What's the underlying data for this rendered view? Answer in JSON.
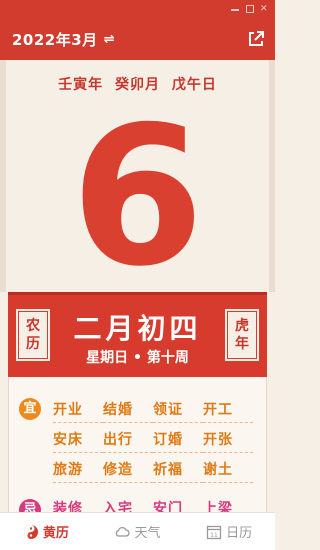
{
  "header": {
    "title": "2022年3月",
    "swap_icon": "⇌",
    "share_icon": "share-icon"
  },
  "calendar": {
    "ganzhi": "壬寅年 癸卯月 戊午日",
    "day": "6",
    "lunar_left_1": "农",
    "lunar_left_2": "历",
    "lunar_date": "二月初四",
    "zodiac_1": "虎",
    "zodiac_2": "年",
    "weekday": "星期日 • 第十周"
  },
  "yi": {
    "badge": "宜",
    "items": [
      "开业",
      "结婚",
      "领证",
      "开工",
      "安床",
      "出行",
      "订婚",
      "开张",
      "旅游",
      "修造",
      "祈福",
      "谢土"
    ]
  },
  "ji": {
    "badge": "忌",
    "items": [
      "装修",
      "入宅",
      "安门",
      "上梁"
    ]
  },
  "tabs": [
    {
      "label": "黄历",
      "icon": "almanac-icon"
    },
    {
      "label": "天气",
      "icon": "cloud-icon"
    },
    {
      "label": "日历",
      "icon": "calendar-icon"
    }
  ],
  "calendar_icon_number": "11",
  "colors": {
    "primary_red": "#d23c2e",
    "yi_orange": "#e07a14",
    "ji_pink": "#d63b7d",
    "paper": "#f6efe6"
  }
}
